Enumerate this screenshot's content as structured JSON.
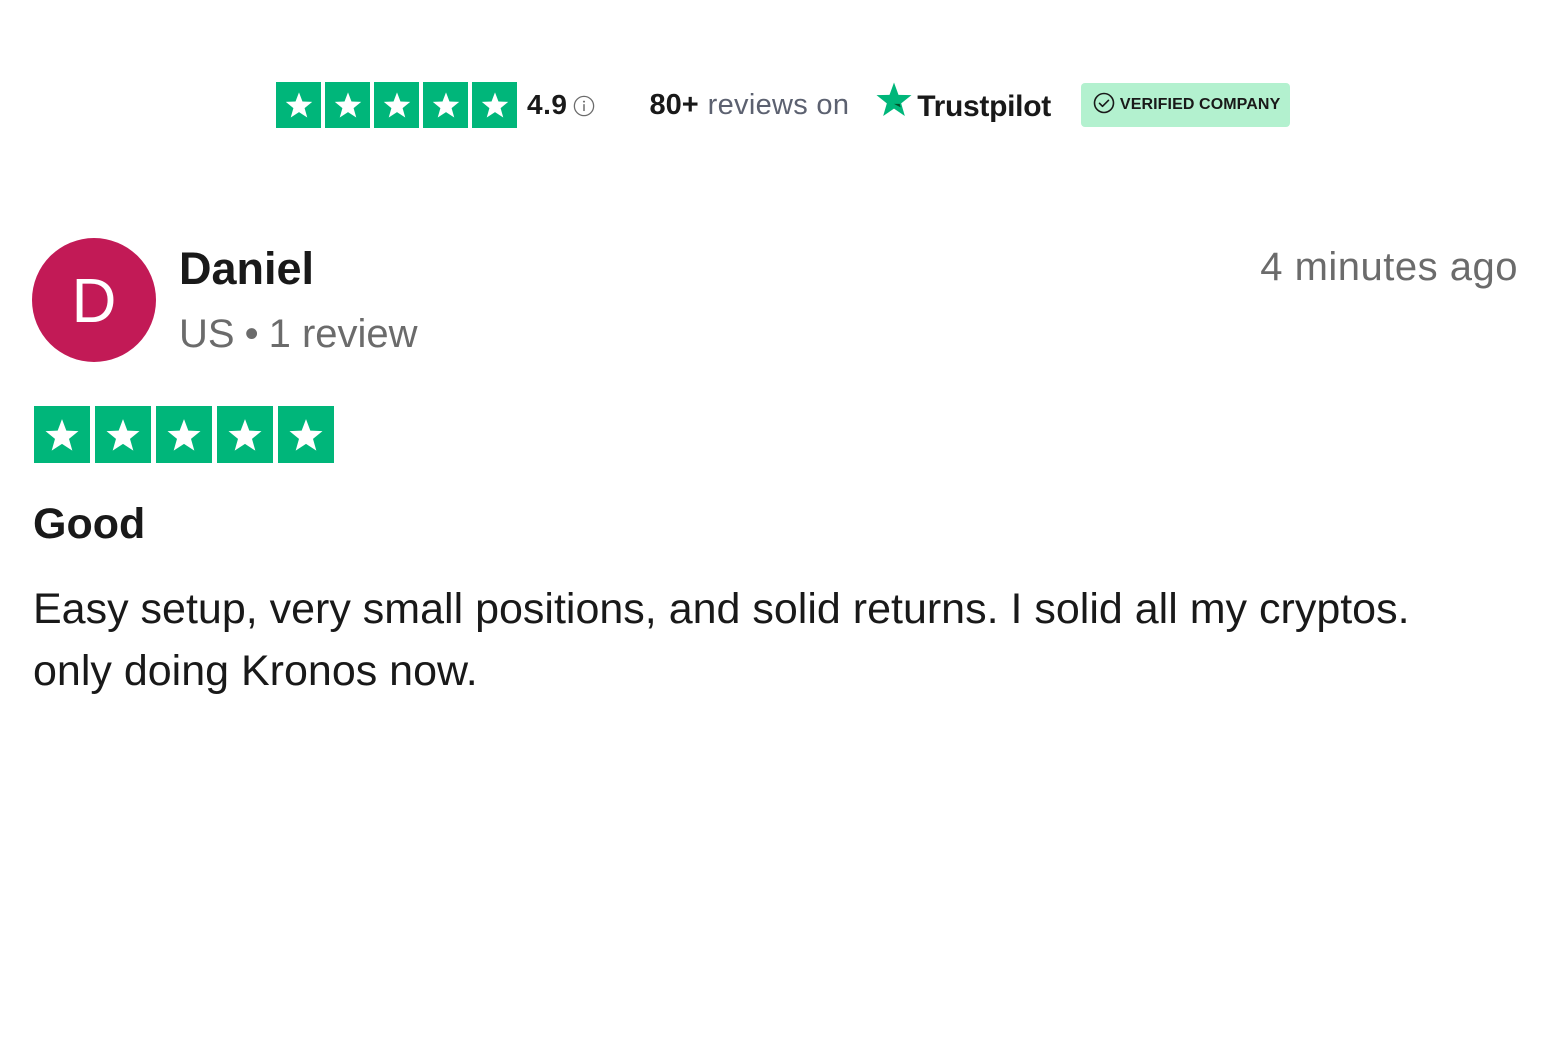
{
  "colors": {
    "star_green": "#00b67a",
    "avatar_bg": "#c21a56",
    "verified_bg": "#b3f1cf",
    "meta_gray": "#6b6b6b"
  },
  "trustbar": {
    "rating": "4.9",
    "stars": 5,
    "info_icon": "info-circle-icon",
    "review_count": "80+",
    "reviews_on": "reviews on",
    "brand_icon": "trustpilot-star-icon",
    "brand_name": "Trustpilot",
    "verified_icon": "check-circle-icon",
    "verified_label": "VERIFIED COMPANY"
  },
  "review": {
    "avatar_letter": "D",
    "name": "Daniel",
    "country": "US",
    "separator": "•",
    "review_count": "1 review",
    "date": "4 minutes ago",
    "stars": 5,
    "title": "Good",
    "body": "Easy setup, very small positions, and solid returns. I solid all my cryptos. only doing Kronos now."
  }
}
